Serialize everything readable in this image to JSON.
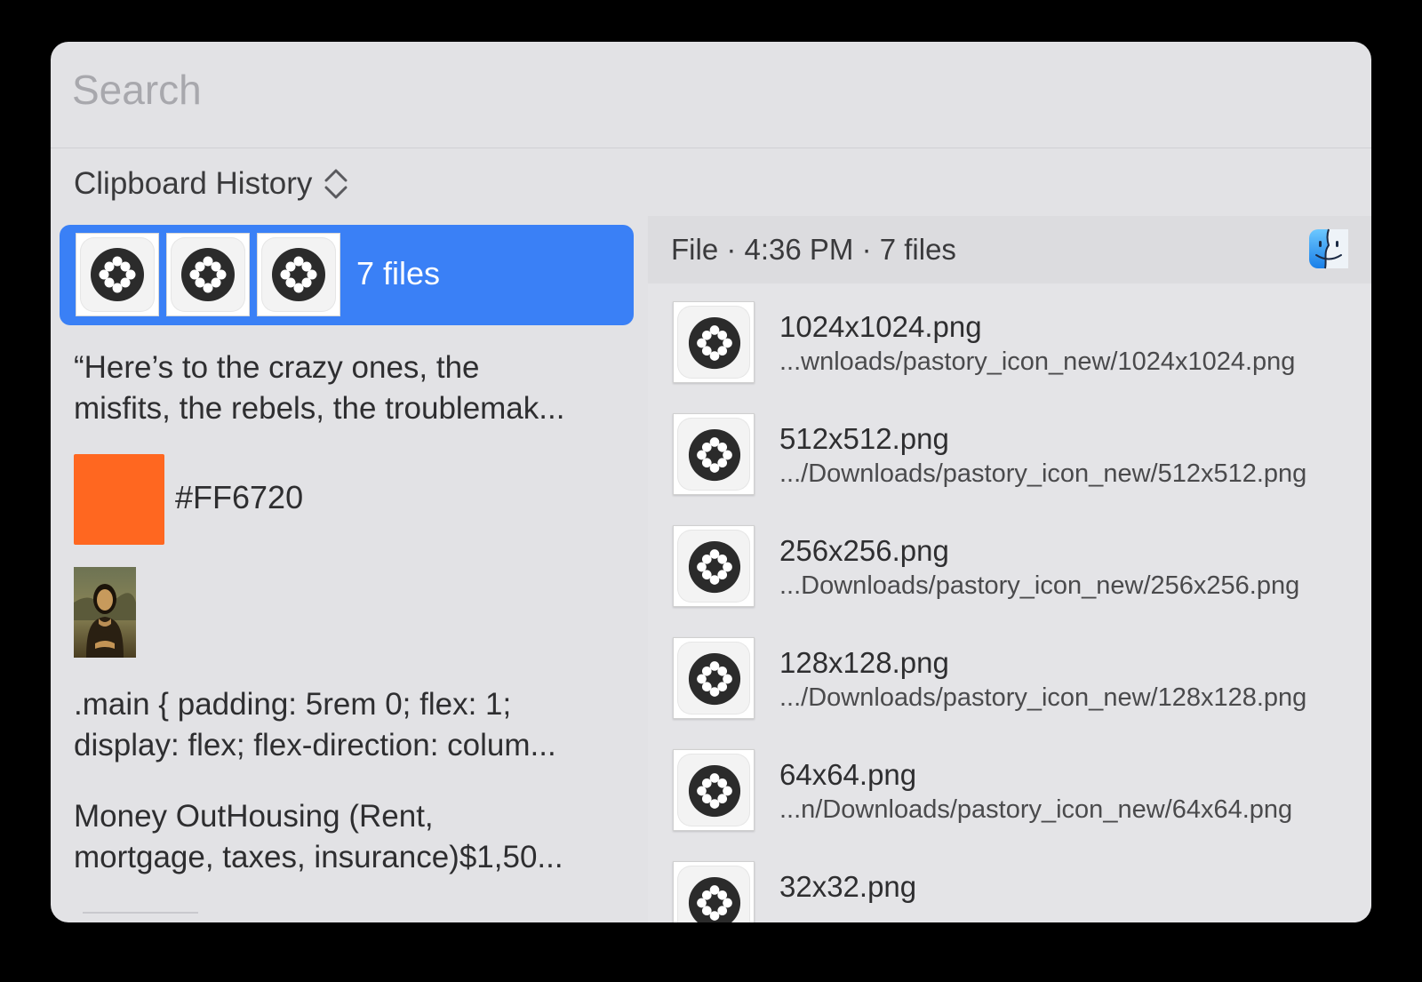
{
  "search": {
    "placeholder": "Search",
    "value": ""
  },
  "section": {
    "title": "Clipboard History",
    "chevron_icon": "chevron-up-down-icon"
  },
  "history": {
    "selected": {
      "label": "7 files",
      "thumbnail_count": 3,
      "icon": "pastory-app-icon"
    },
    "quote": {
      "line1": "“Here’s to the crazy ones, the",
      "line2": "misfits, the rebels, the troublemak..."
    },
    "color": {
      "hex": "#FF6720",
      "label": "#FF6720"
    },
    "image": {
      "icon": "mona-lisa-thumbnail"
    },
    "code": {
      "line1": ".main {  padding: 5rem 0;  flex: 1;",
      "line2": "display: flex;  flex-direction: colum..."
    },
    "money": {
      "line1": "Money OutHousing (Rent,",
      "line2": "mortgage, taxes, insurance)$1,50..."
    }
  },
  "detail": {
    "meta": "File · 4:36 PM · 7 files",
    "app_icon": "finder-icon",
    "files": [
      {
        "name": "1024x1024.png",
        "path": "...wnloads/pastory_icon_new/1024x1024.png"
      },
      {
        "name": "512x512.png",
        "path": ".../Downloads/pastory_icon_new/512x512.png"
      },
      {
        "name": "256x256.png",
        "path": "...Downloads/pastory_icon_new/256x256.png"
      },
      {
        "name": "128x128.png",
        "path": ".../Downloads/pastory_icon_new/128x128.png"
      },
      {
        "name": "64x64.png",
        "path": "...n/Downloads/pastory_icon_new/64x64.png"
      },
      {
        "name": "32x32.png",
        "path": ""
      }
    ]
  },
  "colors": {
    "window_bg": "#e2e2e5",
    "selection_blue": "#3a80f6",
    "swatch": "#FF6720"
  }
}
